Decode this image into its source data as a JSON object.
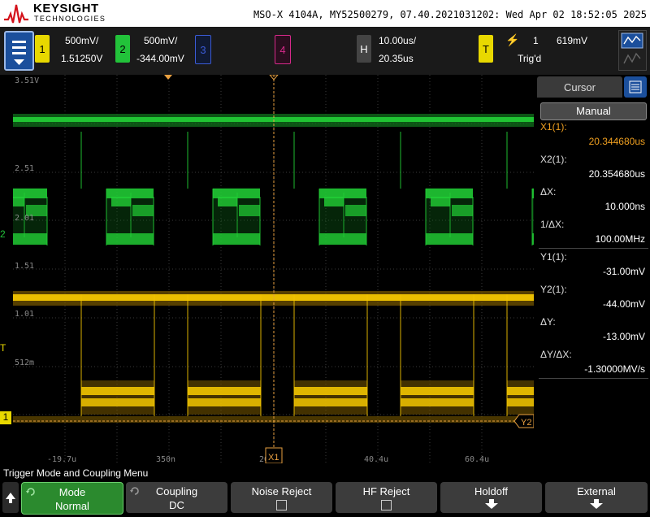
{
  "header": {
    "brand": "KEYSIGHT",
    "brand_sub": "TECHNOLOGIES",
    "info": "MSO-X 4104A, MY52500279, 07.40.2021031202: Wed Apr 02 18:52:05 2025"
  },
  "toolbar": {
    "ch1": {
      "num": "1",
      "scale": "500mV/",
      "offset": "1.51250V",
      "color": "#e8d800"
    },
    "ch2": {
      "num": "2",
      "scale": "500mV/",
      "offset": "-344.00mV",
      "color": "#22c23a"
    },
    "ch3": {
      "num": "3",
      "color": "#3b5bd6"
    },
    "ch4": {
      "num": "4",
      "color": "#d62a8a"
    },
    "horizontal": {
      "label": "H",
      "scale": "10.00us/",
      "delay": "20.35us"
    },
    "trigger": {
      "label": "T",
      "edge_symbol": "⚡",
      "source": "1",
      "level": "619mV",
      "status": "Trig'd"
    }
  },
  "waveform": {
    "left_labels": [
      "3.51V",
      "2.51",
      "2.01",
      "1.51",
      "1.01",
      "512m"
    ],
    "time_labels": [
      "-19.7u",
      "350n",
      "20.",
      "40.4u",
      "60.4u"
    ],
    "cursor_x1": "X1",
    "cursor_y2": "Y2",
    "ch1_marker": "1",
    "ch2_marker": "2",
    "trig_marker": "T"
  },
  "cursor_panel": {
    "tab": "Cursor",
    "mode": "Manual",
    "rows": [
      {
        "label": "X1(1):",
        "value": "20.344680us",
        "highlight": true
      },
      {
        "label": "X2(1):",
        "value": "20.354680us",
        "highlight": false
      },
      {
        "label": "ΔX:",
        "value": "10.000ns",
        "highlight": false
      },
      {
        "label": "1/ΔX:",
        "value": "100.00MHz",
        "highlight": false
      },
      {
        "label": "Y1(1):",
        "value": "-31.00mV",
        "highlight": false
      },
      {
        "label": "Y2(1):",
        "value": "-44.00mV",
        "highlight": false
      },
      {
        "label": "ΔY:",
        "value": "-13.00mV",
        "highlight": false
      },
      {
        "label": "ΔY/ΔX:",
        "value": "-1.30000MV/s",
        "highlight": false
      }
    ]
  },
  "softkeys": {
    "title": "Trigger Mode and Coupling Menu",
    "keys": [
      {
        "label": "Mode",
        "value": "Normal"
      },
      {
        "label": "Coupling",
        "value": "DC"
      },
      {
        "label": "Noise Reject",
        "value": ""
      },
      {
        "label": "HF Reject",
        "value": ""
      },
      {
        "label": "Holdoff",
        "value": ""
      },
      {
        "label": "External",
        "value": ""
      }
    ]
  }
}
